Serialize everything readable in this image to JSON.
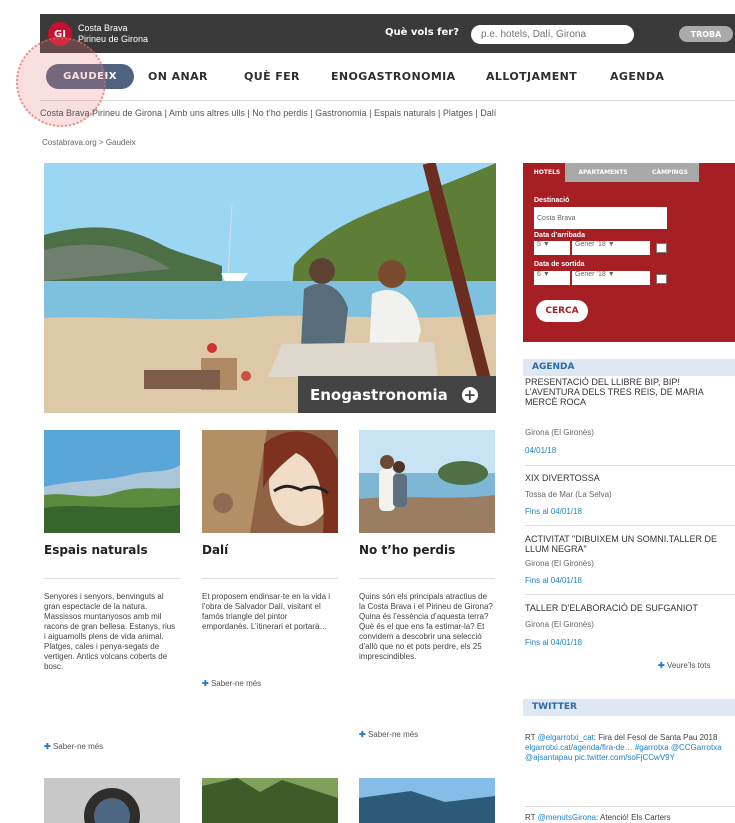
{
  "header": {
    "logo_text": "GI",
    "brand_line1": "Costa Brava",
    "brand_line2": "Pirineu de Girona",
    "search_label": "Què vols fer?",
    "search_placeholder": "p.e. hotels, Dalí, Girona",
    "search_button": "TROBA"
  },
  "nav": {
    "items": [
      "GAUDEIX",
      "ON ANAR",
      "QUÈ FER",
      "ENOGASTRONOMIA",
      "ALLOTJAMENT",
      "AGENDA"
    ]
  },
  "subnav": "Costa Brava Pirineu de Girona | Amb uns altres ulls | No t’ho perdis | Gastronomia | Espais naturals | Platges | Dalí",
  "breadcrumb": "Costabrava.org > Gaudeix",
  "hero": {
    "caption": "Enogastronomia",
    "caption_icon": "plus-circle-icon"
  },
  "cards": [
    {
      "title": "Espais naturals",
      "text": "Senyores i senyors, benvinguts al gran espectacle de la natura. Massissos muntanyosos amb mil racons de gran bellesa. Estanys, rius i aiguamolls plens de vida animal. Platges, cales i penya-segats de vertigen. Antics volcans coberts de bosc.",
      "more": "Saber-ne més"
    },
    {
      "title": "Dalí",
      "text": "Et proposem endinsar-te en la vida i l’obra de Salvador Dalí, visitant el famós triangle del pintor empordanès. L’itinerari et portarà…",
      "more": "Saber-ne més"
    },
    {
      "title": "No t’ho perdis",
      "text": "Quins són els principals atractius de la Costa Brava i el Pirineu de Girona? Quina és l’essència d’aquesta terra? Què és el que ens fa estimar-la? Et convidem a descobrir una selecció d’allò que no et pots perdre, els 25 imprescindibles.",
      "more": "Saber-ne més"
    }
  ],
  "booking": {
    "tabs": [
      "HOTELS",
      "APARTAMENTS",
      "CÀMPINGS"
    ],
    "destination_label": "Destinació",
    "destination_value": "Costa Brava",
    "arrival_label": "Data d’arribada",
    "arrival_day": "5",
    "arrival_month": "Gener ’18",
    "departure_label": "Data de sortida",
    "departure_day": "6",
    "departure_month": "Gener ’18",
    "search_button": "CERCA"
  },
  "agenda": {
    "heading": "AGENDA",
    "events": [
      {
        "title": "PRESENTACIÓ DEL LLIBRE BIP, BIP! L’AVENTURA DELS TRES REIS, DE MARIA MERCÈ ROCA",
        "place": "Girona (El Gironès)",
        "date": "04/01/18"
      },
      {
        "title": "XIX DIVERTOSSA",
        "place": "Tossa de Mar (La Selva)",
        "date": "Fins al 04/01/18"
      },
      {
        "title": "ACTIVITAT \"DIBUIXEM UN SOMNI.TALLER DE LLUM NEGRA\"",
        "place": "Girona (El Gironès)",
        "date": "Fins al 04/01/18"
      },
      {
        "title": "TALLER D’ELABORACIÓ DE SUFGANIOT",
        "place": "Girona (El Gironès)",
        "date": "Fins al 04/01/18"
      }
    ],
    "see_all": "Veure’ls tots"
  },
  "twitter": {
    "heading": "TWITTER",
    "tweet1_prefix": "RT ",
    "tweet1_handle": "@elgarrotxi_cat",
    "tweet1_text": ": Fira del Fesol de Santa Pau 2018",
    "tweet1_link": "elgarrotxi.cat/agenda/fira-de… #garrotxa @CCGarrotxa @ajsantapau pic.twitter.com/soFjCCwV9Y",
    "tweet2_prefix": "RT ",
    "tweet2_handle": "@menutsGirona",
    "tweet2_text": ": Atenció! Els Carters"
  }
}
